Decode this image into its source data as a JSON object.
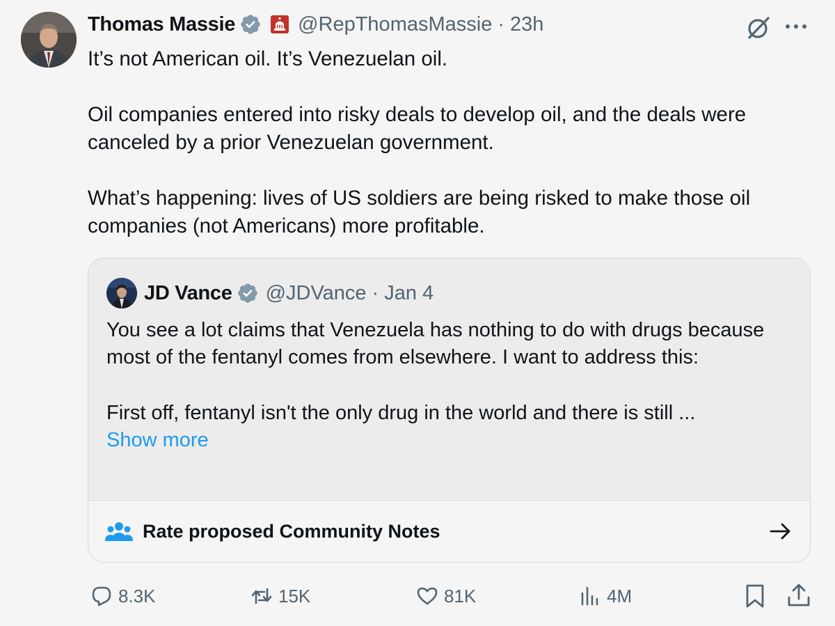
{
  "tweet": {
    "author_name": "Thomas Massie",
    "handle": "@RepThomasMassie",
    "separator": "·",
    "time": "23h",
    "paragraphs": [
      "It’s not American oil. It’s Venezuelan oil.",
      "Oil companies entered into risky deals to develop oil, and the deals were canceled by a prior Venezuelan government.",
      "What’s happening: lives of US soldiers are being risked to make those oil companies (not Americans) more profitable."
    ],
    "icons": {
      "avatar": "avatar-photo",
      "verified": "verified-badge-icon",
      "affiliation": "us-government-flag-icon",
      "grok": "grok-icon",
      "more": "more-options-icon"
    }
  },
  "quoted_tweet": {
    "author_name": "JD Vance",
    "handle": "@JDVance",
    "separator": "·",
    "time": "Jan 4",
    "paragraphs": [
      "You see a lot claims that Venezuela has nothing to do with drugs because most of the fentanyl comes from elsewhere. I want to address this:",
      "First off, fentanyl isn't the only drug in the world and there is still ..."
    ],
    "show_more": "Show more"
  },
  "community_notes": {
    "label": "Rate proposed Community Notes",
    "icon": "people-group-icon",
    "arrow": "arrow-right-icon"
  },
  "actions": {
    "replies": "8.3K",
    "reposts": "15K",
    "likes": "81K",
    "views": "4M"
  },
  "colors": {
    "background": "#f5f5f5",
    "quote_background": "#ececec",
    "text": "#0f1419",
    "muted": "#536471",
    "link": "#1d9bf0",
    "verified": "#829aab",
    "border": "#cfd9de"
  }
}
